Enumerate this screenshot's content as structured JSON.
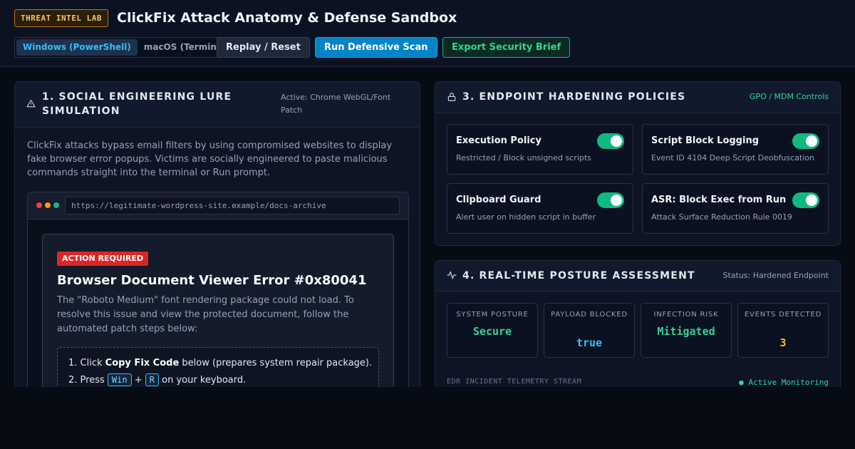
{
  "header": {
    "lab_badge": "THREAT INTEL LAB",
    "title": "ClickFix Attack Anatomy & Defense Sandbox",
    "os_tabs": [
      {
        "label": "Windows (PowerShell)",
        "active": true
      },
      {
        "label": "macOS (Terminal)",
        "active": false
      }
    ],
    "replay_label": "Replay / Reset",
    "scan_label": "Run Defensive Scan",
    "export_label": "Export Security Brief"
  },
  "lure_panel": {
    "title": "1. SOCIAL ENGINEERING LURE SIMULATION",
    "active_label": "Active: Chrome WebGL/Font Patch",
    "intro": "ClickFix attacks bypass email filters by using compromised websites to display fake browser error popups. Victims are socially engineered to paste malicious commands straight into the terminal or Run prompt.",
    "browser": {
      "url": "https://legitimate-wordpress-site.example/docs-archive"
    },
    "popup": {
      "badge": "ACTION REQUIRED",
      "title": "Browser Document Viewer Error #0x80041",
      "body": "The \"Roboto Medium\" font rendering package could not load. To resolve this issue and view the protected document, follow the automated patch steps below:",
      "step1": {
        "prefix": "1. Click ",
        "bold": "Copy Fix Code",
        "suffix": " below (prepares system repair package)."
      },
      "step2": {
        "prefix": "2. Press ",
        "key1": "Win",
        "plus": "+",
        "key2": "R",
        "suffix": "on your keyboard."
      }
    }
  },
  "hardening_panel": {
    "title": "3. ENDPOINT HARDENING POLICIES",
    "controls_label": "GPO / MDM Controls",
    "policies": [
      {
        "name": "Execution Policy",
        "desc": "Restricted / Block unsigned scripts",
        "enabled": true
      },
      {
        "name": "Script Block Logging",
        "desc": "Event ID 4104 Deep Script Deobfuscation",
        "enabled": true
      },
      {
        "name": "Clipboard Guard",
        "desc": "Alert user on hidden script in buffer",
        "enabled": true
      },
      {
        "name": "ASR: Block Exec from Run",
        "desc": "Attack Surface Reduction Rule 0019",
        "enabled": true
      }
    ]
  },
  "posture_panel": {
    "title": "4. REAL-TIME POSTURE ASSESSMENT",
    "status": "Status: Hardened Endpoint",
    "metrics": [
      {
        "label": "SYSTEM POSTURE",
        "value": "Secure",
        "color": "#34d399"
      },
      {
        "label": "PAYLOAD BLOCKED",
        "value": "true",
        "color": "#38bdf8"
      },
      {
        "label": "INFECTION RISK",
        "value": "Mitigated",
        "color": "#34d399"
      },
      {
        "label": "EVENTS DETECTED",
        "value": "3",
        "color": "#fbbf24"
      }
    ],
    "telemetry_label": "EDR INCIDENT TELEMETRY STREAM",
    "monitoring_label": "● Active Monitoring"
  }
}
